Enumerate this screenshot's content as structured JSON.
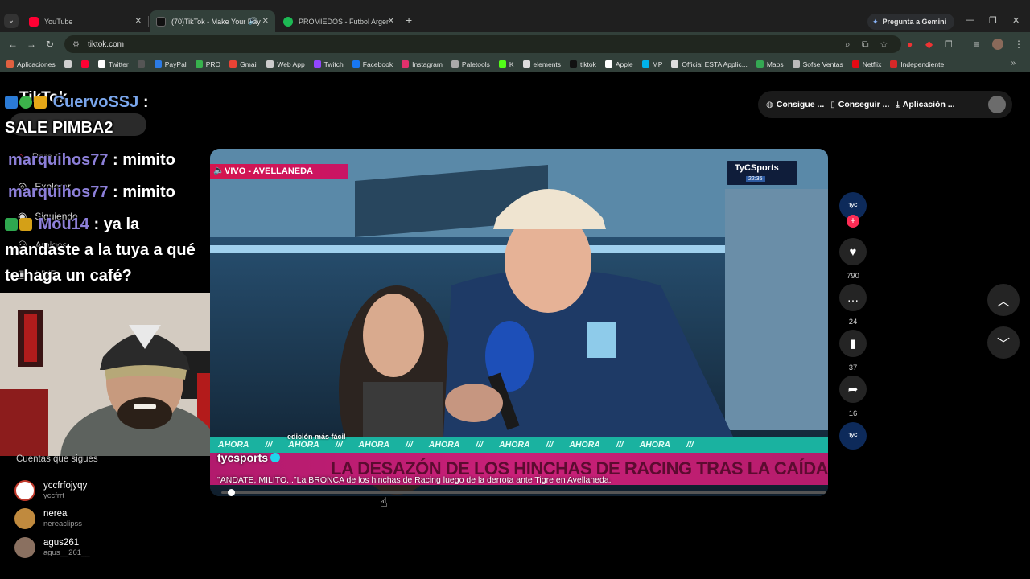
{
  "browser": {
    "tabs": [
      {
        "title": "YouTube",
        "favicon_color": "#ff0033",
        "active": false
      },
      {
        "title": "(70)TikTok - Make Your Day",
        "favicon_color": "#111111",
        "active": true
      },
      {
        "title": "PROMIEDOS - Futbol Argentino",
        "favicon_color": "#1db954",
        "active": false
      }
    ],
    "gemini_label": "Pregunta a Gemini",
    "url": "tiktok.com",
    "bookmarks": [
      {
        "label": "Aplicaciones",
        "color": "#e06040"
      },
      {
        "label": "",
        "color": "#cfcfcf"
      },
      {
        "label": "",
        "color": "#ff0033"
      },
      {
        "label": "Twitter",
        "color": "#ffffff"
      },
      {
        "label": "",
        "color": "#555555"
      },
      {
        "label": "PayPal",
        "color": "#2c7be5"
      },
      {
        "label": "PRO",
        "color": "#37b24d"
      },
      {
        "label": "Gmail",
        "color": "#ea4335"
      },
      {
        "label": "Web App",
        "color": "#cccccc"
      },
      {
        "label": "Twitch",
        "color": "#9146ff"
      },
      {
        "label": "Facebook",
        "color": "#1877f2"
      },
      {
        "label": "Instagram",
        "color": "#e1306c"
      },
      {
        "label": "Paletools",
        "color": "#aaaaaa"
      },
      {
        "label": "K",
        "color": "#53fc18"
      },
      {
        "label": "elements",
        "color": "#dddddd"
      },
      {
        "label": "tiktok",
        "color": "#111111"
      },
      {
        "label": "Apple",
        "color": "#ffffff"
      },
      {
        "label": "MP",
        "color": "#00b1ea"
      },
      {
        "label": "Official ESTA Applic...",
        "color": "#dddddd"
      },
      {
        "label": "Maps",
        "color": "#34a853"
      },
      {
        "label": "Sofse Ventas",
        "color": "#bbbbbb"
      },
      {
        "label": "Netflix",
        "color": "#e50914"
      },
      {
        "label": "Independiente",
        "color": "#d62828"
      }
    ]
  },
  "sidebar": {
    "logo": "TikTok",
    "nav": [
      "Para ti",
      "Explorar",
      "Siguiendo",
      "Amigos",
      "LIVE"
    ]
  },
  "chat": [
    {
      "user": "CuervoSSJ",
      "sep": " :",
      "msg": "SALE PIMBA2",
      "user_color": "#7aa6ec"
    },
    {
      "user": "marquihos77",
      "sep": " :",
      "msg": "mimito",
      "user_color": "#8c7fd8"
    },
    {
      "user": "marquihos77",
      "sep": " :",
      "msg": "mimito",
      "user_color": "#8c7fd8"
    },
    {
      "user": "Mou14",
      "sep": " :",
      "msg": "ya la mandaste a la tuya a qué te haga un café?",
      "user_color": "#8c7fd8"
    }
  ],
  "following": {
    "title": "Cuentas que sigues",
    "accounts": [
      {
        "name": "yccfrfojyqy",
        "handle": "yccfrrt",
        "color": "#c0392b"
      },
      {
        "name": "nerea",
        "handle": "nereaclipss",
        "color": "#c08a3e"
      },
      {
        "name": "agus261",
        "handle": "agus__261__",
        "color": "#8a7060"
      }
    ]
  },
  "top_pills": [
    "Consigue ...",
    "Conseguir ...",
    "Aplicación ..."
  ],
  "video": {
    "live_tag": "VIVO - AVELLANEDA",
    "channel_logo": "TyCSports",
    "clock": "22:35",
    "ahora_text": "AHORA",
    "edition_tag": "edición más fácil",
    "headline": "LA DESAZÓN DE LOS HINCHAS DE RACING TRAS LA CAÍDA ANTE TIGRE",
    "author": "tycsports",
    "caption": "\"ANDATE, MILITO...\"La BRONCA de los hinchas de Racing luego de la derrota ante Tigre en Avellaneda.",
    "progress": 0.01
  },
  "actions": {
    "likes": "790",
    "comments": "24",
    "saves": "37",
    "shares": "16"
  }
}
